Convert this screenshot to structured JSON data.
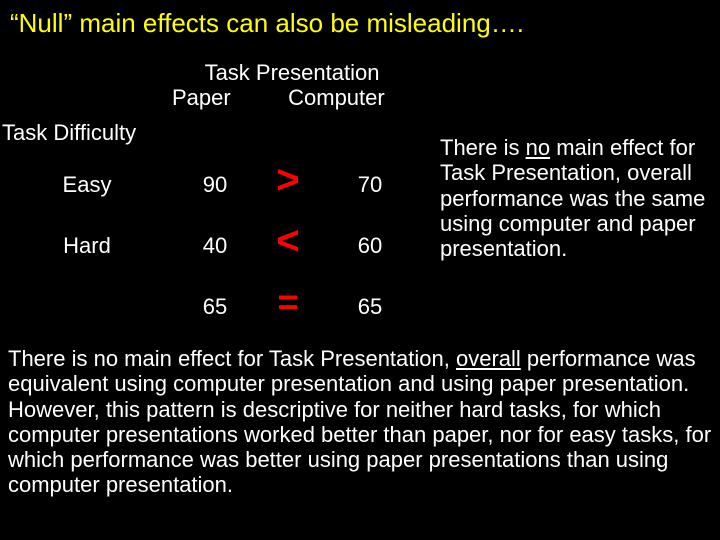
{
  "title": "“Null” main effects can also be misleading….",
  "headers": {
    "top": "Task Presentation",
    "col1": "Paper",
    "col2": "Computer",
    "rowhead": "Task Difficulty",
    "row1": "Easy",
    "row2": "Hard"
  },
  "cells": {
    "paper_easy": "90",
    "comp_easy": "70",
    "paper_hard": "40",
    "comp_hard": "60",
    "paper_marg": "65",
    "comp_marg": "65"
  },
  "ops": {
    "easy": ">",
    "hard": "<",
    "marg": "="
  },
  "side": {
    "pre": "There is ",
    "no": "no",
    "post": " main effect for Task Presentation, overall performance was the same using computer and paper presentation."
  },
  "bottom": {
    "pre": "There is no main effect for Task Presentation, ",
    "u": "overall",
    "post": " performance was equivalent using computer presentation and using paper presentation.  However, this pattern is descriptive for neither hard tasks, for which computer presentations worked better than paper, nor for easy tasks, for which performance was better using paper presentations than using computer presentation."
  }
}
